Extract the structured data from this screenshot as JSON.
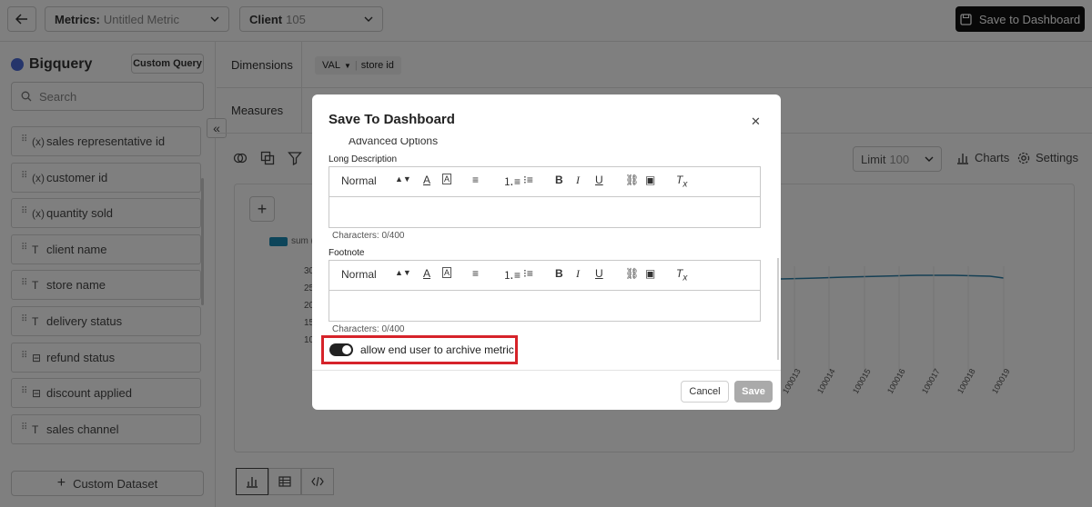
{
  "topbar": {
    "metrics_label": "Metrics:",
    "metrics_value": "Untitled Metric",
    "client_label": "Client",
    "client_value": "105",
    "save_to_dashboard": "Save to Dashboard"
  },
  "sidebar": {
    "source_name": "Bigquery",
    "custom_query": "Custom Query",
    "search_placeholder": "Search",
    "fields": [
      {
        "label": "sales representative id",
        "type_glyph": "(x)"
      },
      {
        "label": "customer id",
        "type_glyph": "(x)"
      },
      {
        "label": "quantity sold",
        "type_glyph": "(x)"
      },
      {
        "label": "client name",
        "type_glyph": "T"
      },
      {
        "label": "store name",
        "type_glyph": "T"
      },
      {
        "label": "delivery status",
        "type_glyph": "T"
      },
      {
        "label": "refund status",
        "type_glyph": "⊟"
      },
      {
        "label": "discount applied",
        "type_glyph": "⊟"
      },
      {
        "label": "sales channel",
        "type_glyph": "T"
      }
    ],
    "custom_dataset": "Custom Dataset"
  },
  "main": {
    "dimensions_label": "Dimensions",
    "dimension_chip": {
      "agg": "VAL",
      "field": "store id"
    },
    "measures_label": "Measures",
    "limit_label": "Limit",
    "limit_value": "100",
    "charts_label": "Charts",
    "settings_label": "Settings",
    "legend_label": "sum (",
    "y_ticks": [
      "30",
      "25",
      "20",
      "15",
      "10"
    ],
    "x_ticks": [
      "100013",
      "100014",
      "100015",
      "100016",
      "100017",
      "100018",
      "100019"
    ]
  },
  "modal": {
    "title": "Save To Dashboard",
    "advanced_options": "Advanced Options",
    "long_description_label": "Long Description",
    "footnote_label": "Footnote",
    "format_value": "Normal",
    "long_description_counter": "Characters: 0/400",
    "footnote_counter": "Characters: 0/400",
    "toggle_label": "allow end user to archive metric",
    "toggle_on": true,
    "cancel": "Cancel",
    "save": "Save"
  }
}
